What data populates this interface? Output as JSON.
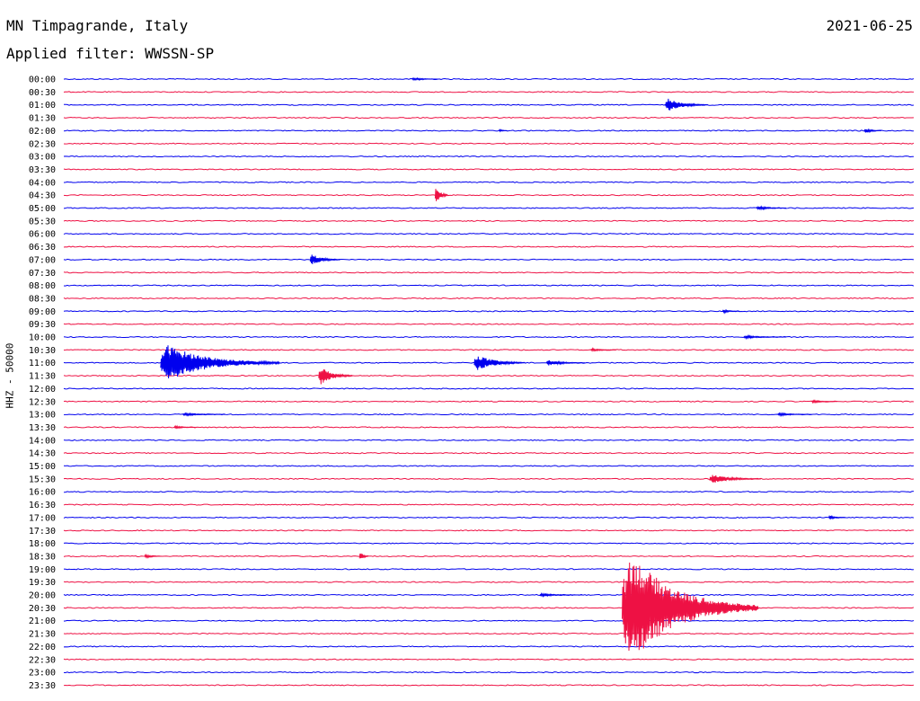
{
  "header": {
    "title": "MN Timpagrande, Italy",
    "date": "2021-06-25",
    "filter": "Applied filter: WWSSN-SP"
  },
  "colors": {
    "blue": "#0000ee",
    "red": "#ee1144"
  },
  "chart_data": {
    "type": "line",
    "title": "MN Timpagrande, Italy",
    "ylabel": "HHZ - 50000",
    "xlabel": "",
    "row_labels": [
      "00:00",
      "00:30",
      "01:00",
      "01:30",
      "02:00",
      "02:30",
      "03:00",
      "03:30",
      "04:00",
      "04:30",
      "05:00",
      "05:30",
      "06:00",
      "06:30",
      "07:00",
      "07:30",
      "08:00",
      "08:30",
      "09:00",
      "09:30",
      "10:00",
      "10:30",
      "11:00",
      "11:30",
      "12:00",
      "12:30",
      "13:00",
      "13:30",
      "14:00",
      "14:30",
      "15:00",
      "15:30",
      "16:00",
      "16:30",
      "17:00",
      "17:30",
      "18:00",
      "18:30",
      "19:00",
      "19:30",
      "20:00",
      "20:30",
      "21:00",
      "21:30",
      "22:00",
      "22:30",
      "23:00",
      "23:30"
    ],
    "row_colors": [
      "blue",
      "red"
    ],
    "row_span_minutes": 30,
    "events": [
      {
        "row": 0,
        "start": 0.41,
        "dur": 0.03,
        "amp": 1.5
      },
      {
        "row": 2,
        "start": 0.708,
        "dur": 0.05,
        "amp": 7
      },
      {
        "row": 4,
        "start": 0.512,
        "dur": 0.01,
        "amp": 1.5
      },
      {
        "row": 4,
        "start": 0.942,
        "dur": 0.02,
        "amp": 3
      },
      {
        "row": 9,
        "start": 0.437,
        "dur": 0.015,
        "amp": 11
      },
      {
        "row": 10,
        "start": 0.815,
        "dur": 0.035,
        "amp": 2
      },
      {
        "row": 14,
        "start": 0.29,
        "dur": 0.035,
        "amp": 6
      },
      {
        "row": 18,
        "start": 0.775,
        "dur": 0.02,
        "amp": 2
      },
      {
        "row": 20,
        "start": 0.8,
        "dur": 0.05,
        "amp": 1.5
      },
      {
        "row": 21,
        "start": 0.62,
        "dur": 0.03,
        "amp": 1.5
      },
      {
        "row": 22,
        "start": 0.114,
        "dur": 0.14,
        "amp": 20
      },
      {
        "row": 22,
        "start": 0.483,
        "dur": 0.06,
        "amp": 9
      },
      {
        "row": 22,
        "start": 0.568,
        "dur": 0.045,
        "amp": 3
      },
      {
        "row": 23,
        "start": 0.3,
        "dur": 0.04,
        "amp": 10
      },
      {
        "row": 25,
        "start": 0.88,
        "dur": 0.03,
        "amp": 1.5
      },
      {
        "row": 26,
        "start": 0.14,
        "dur": 0.05,
        "amp": 1.5
      },
      {
        "row": 26,
        "start": 0.84,
        "dur": 0.04,
        "amp": 1.5
      },
      {
        "row": 27,
        "start": 0.13,
        "dur": 0.025,
        "amp": 1.5
      },
      {
        "row": 31,
        "start": 0.76,
        "dur": 0.06,
        "amp": 5
      },
      {
        "row": 34,
        "start": 0.9,
        "dur": 0.02,
        "amp": 2
      },
      {
        "row": 37,
        "start": 0.095,
        "dur": 0.02,
        "amp": 2
      },
      {
        "row": 37,
        "start": 0.348,
        "dur": 0.01,
        "amp": 6
      },
      {
        "row": 40,
        "start": 0.56,
        "dur": 0.05,
        "amp": 1.5
      },
      {
        "row": 41,
        "start": 0.657,
        "dur": 0.16,
        "amp": 62
      }
    ]
  }
}
